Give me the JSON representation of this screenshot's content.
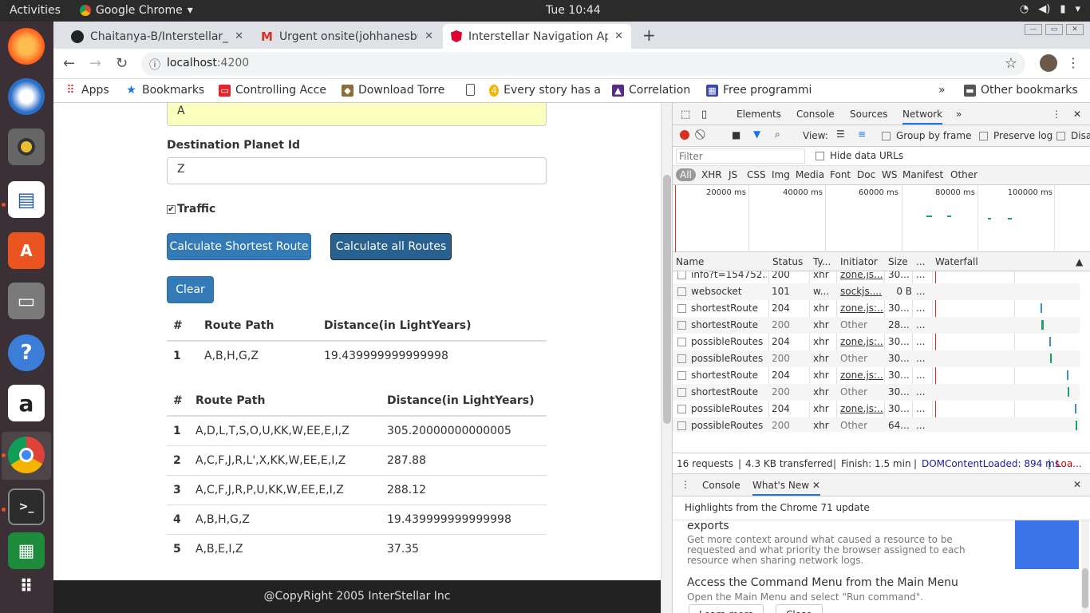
{
  "topbar": {
    "activities": "Activities",
    "app": "Google Chrome",
    "clock": "Tue 10:44"
  },
  "dock": {
    "items": [
      "firefox",
      "thunderbird",
      "rhythmbox",
      "writer",
      "software",
      "files",
      "help",
      "amazon",
      "chrome",
      "terminal",
      "spreadsheet",
      "apps"
    ]
  },
  "tabs": [
    {
      "title": "Chaitanya-B/Interstellar_l",
      "icon": "github-icon"
    },
    {
      "title": "Urgent onsite(johhanesbu",
      "icon": "gmail-icon"
    },
    {
      "title": "Interstellar Navigation Ap",
      "icon": "angular-icon"
    }
  ],
  "omnibox": {
    "host": "localhost",
    "port": ":4200"
  },
  "bookmarks": [
    "Apps",
    "Bookmarks",
    "Controlling Acce",
    "Download Torre",
    "Every story has a",
    "Correlation",
    "Free programmi",
    "Other bookmarks"
  ],
  "form": {
    "source_value": "A",
    "dest_label": "Destination Planet Id",
    "dest_value": "Z",
    "traffic_label": "Traffic",
    "btn_shortest": "Calculate Shortest Route",
    "btn_all": "Calculate all Routes",
    "btn_clear": "Clear"
  },
  "shortest_table": {
    "headers": [
      "#",
      "Route Path",
      "Distance(in LightYears)"
    ],
    "rows": [
      [
        "1",
        "A,B,H,G,Z",
        "19.439999999999998"
      ]
    ]
  },
  "all_table": {
    "headers": [
      "#",
      "Route Path",
      "Distance(in LightYears)"
    ],
    "rows": [
      [
        "1",
        "A,D,L,T,S,O,U,KK,W,EE,E,I,Z",
        "305.20000000000005"
      ],
      [
        "2",
        "A,C,F,J,R,L',X,KK,W,EE,E,I,Z",
        "287.88"
      ],
      [
        "3",
        "A,C,F,J,R,P,U,KK,W,EE,E,I,Z",
        "288.12"
      ],
      [
        "4",
        "A,B,H,G,Z",
        "19.439999999999998"
      ],
      [
        "5",
        "A,B,E,I,Z",
        "37.35"
      ]
    ]
  },
  "footer": "@CopyRight 2005 InterStellar Inc",
  "devtools": {
    "tabs": [
      "Elements",
      "Console",
      "Sources",
      "Network"
    ],
    "view_label": "View:",
    "group_by_frame": "Group by frame",
    "preserve_log": "Preserve log",
    "disable_cache": "Disa",
    "filter_placeholder": "Filter",
    "hide_data_urls": "Hide data URLs",
    "types": [
      "All",
      "XHR",
      "JS",
      "CSS",
      "Img",
      "Media",
      "Font",
      "Doc",
      "WS",
      "Manifest",
      "Other"
    ],
    "overview_labels": [
      "20000 ms",
      "40000 ms",
      "60000 ms",
      "80000 ms",
      "100000 ms"
    ],
    "columns": [
      "Name",
      "Status",
      "Ty...",
      "Initiator",
      "Size",
      "...",
      "Waterfall"
    ],
    "rows": [
      {
        "name": "info?t=154752...",
        "status": "200",
        "type": "xhr",
        "initiator": "zone.js...",
        "size": "30..."
      },
      {
        "name": "websocket",
        "status": "101",
        "type": "w...",
        "initiator": "sockjs....",
        "size": "0 B"
      },
      {
        "name": "shortestRoute",
        "status": "204",
        "type": "xhr",
        "initiator": "zone.js:...",
        "size": "30..."
      },
      {
        "name": "shortestRoute",
        "status": "200",
        "type": "xhr",
        "initiator": "Other",
        "size": "28..."
      },
      {
        "name": "possibleRoutes",
        "status": "204",
        "type": "xhr",
        "initiator": "zone.js:...",
        "size": "30..."
      },
      {
        "name": "possibleRoutes",
        "status": "200",
        "type": "xhr",
        "initiator": "Other",
        "size": "30..."
      },
      {
        "name": "shortestRoute",
        "status": "204",
        "type": "xhr",
        "initiator": "zone.js:...",
        "size": "30..."
      },
      {
        "name": "shortestRoute",
        "status": "200",
        "type": "xhr",
        "initiator": "Other",
        "size": "30..."
      },
      {
        "name": "possibleRoutes",
        "status": "204",
        "type": "xhr",
        "initiator": "zone.js:...",
        "size": "30..."
      },
      {
        "name": "possibleRoutes",
        "status": "200",
        "type": "xhr",
        "initiator": "Other",
        "size": "64..."
      }
    ],
    "summary": {
      "requests": "16 requests",
      "transferred": "4.3 KB transferred",
      "finish": "Finish: 1.5 min",
      "dcl": "DOMContentLoaded: 894 ms",
      "load": "Loa..."
    },
    "drawer_tabs": [
      "Console",
      "What's New"
    ],
    "whatsnew": {
      "highlight": "Highlights from the Chrome 71 update",
      "h1": "exports",
      "p1": "Get more context around what caused a resource to be requested and what priority the browser assigned to each resource when sharing network logs.",
      "h2": "Access the Command Menu from the Main Menu",
      "p2": "Open the Main Menu and select \"Run command\".",
      "learn_more": "Learn more",
      "close": "Close"
    }
  }
}
